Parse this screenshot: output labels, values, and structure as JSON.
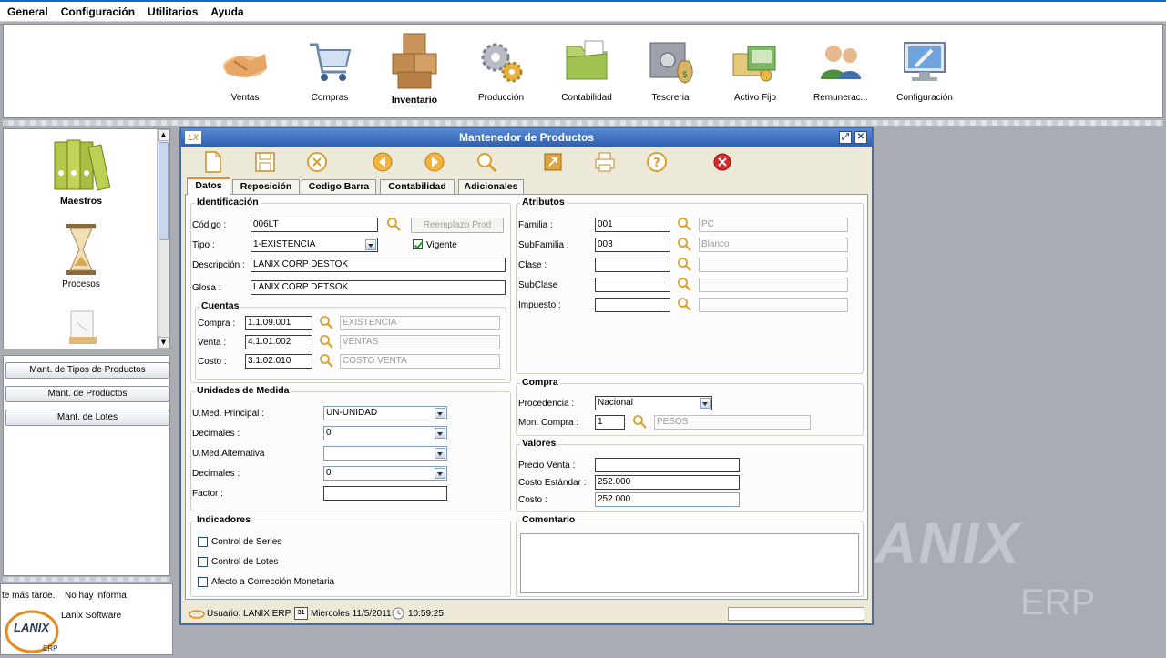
{
  "menu": [
    "General",
    "Configuración",
    "Utilitarios",
    "Ayuda"
  ],
  "toolbar": [
    {
      "label": "Ventas",
      "icon": "handshake-icon"
    },
    {
      "label": "Compras",
      "icon": "shopping-cart-icon"
    },
    {
      "label": "Inventario",
      "icon": "boxes-icon"
    },
    {
      "label": "Producción",
      "icon": "gears-icon"
    },
    {
      "label": "Contabilidad",
      "icon": "folder-icon"
    },
    {
      "label": "Tesoreria",
      "icon": "safe-icon"
    },
    {
      "label": "Activo Fijo",
      "icon": "assets-icon"
    },
    {
      "label": "Remunerac...",
      "icon": "people-icon"
    },
    {
      "label": "Configuración",
      "icon": "monitor-wrench-icon"
    }
  ],
  "left": {
    "modules": [
      {
        "label": "Maestros",
        "icon": "binders-icon"
      },
      {
        "label": "Procesos",
        "icon": "hourglass-icon"
      }
    ],
    "buttons": [
      "Mant. de Tipos de Productos",
      "Mant. de Productos",
      "Mant. de Lotes"
    ],
    "bottom": {
      "line1": "te más tarde.",
      "line1b": "No hay informa",
      "line2": "Lanix Software",
      "logo": "LANIX",
      "logo_sub": "ERP"
    }
  },
  "watermark": {
    "brand": "ANIX",
    "sub": "ERP"
  },
  "window": {
    "title": "Mantenedor de Productos",
    "logo": "LX",
    "tools": [
      "new-document-icon",
      "save-icon",
      "cancel-icon",
      "previous-icon",
      "next-icon",
      "search-icon",
      "export-icon",
      "print-icon",
      "help-icon",
      "close-icon"
    ],
    "tabs": [
      "Datos",
      "Reposición",
      "Codigo Barra",
      "Contabilidad",
      "Adicionales"
    ],
    "identificacion": {
      "title": "Identificación",
      "codigo_label": "Código :",
      "codigo": "006LT",
      "reemplazo": "Reemplazo Prod",
      "tipo_label": "Tipo :",
      "tipo": "1-EXISTENCIA",
      "vigente": "Vigente",
      "descripcion_label": "Descripción :",
      "descripcion": "LANIX CORP DESTOK",
      "glosa_label": "Glosa :",
      "glosa": "LANIX CORP DETSOK"
    },
    "cuentas": {
      "title": "Cuentas",
      "rows": [
        {
          "label": "Compra :",
          "code": "1.1.09.001",
          "desc": "EXISTENCIA"
        },
        {
          "label": "Venta :",
          "code": "4.1.01.002",
          "desc": "VENTAS"
        },
        {
          "label": "Costo :",
          "code": "3.1.02.010",
          "desc": "COSTO VENTA"
        }
      ]
    },
    "atributos": {
      "title": "Atributos",
      "rows": [
        {
          "label": "Familia :",
          "code": "001",
          "desc": "PC"
        },
        {
          "label": "SubFamilia :",
          "code": "003",
          "desc": "Blanco"
        },
        {
          "label": "Clase :",
          "code": "",
          "desc": ""
        },
        {
          "label": "SubClase",
          "code": "",
          "desc": ""
        },
        {
          "label": "Impuesto :",
          "code": "",
          "desc": ""
        }
      ]
    },
    "unidades": {
      "title": "Unidades de Medida",
      "umed_label": "U.Med. Principal :",
      "umed": "UN-UNIDAD",
      "dec1_label": "Decimales :",
      "dec1": "0",
      "umed_alt_label": "U.Med.Alternativa",
      "umed_alt": "",
      "dec2_label": "Decimales :",
      "dec2": "0",
      "factor_label": "Factor :",
      "factor": ""
    },
    "compra": {
      "title": "Compra",
      "procedencia_label": "Procedencia :",
      "procedencia": "Nacional",
      "moneda_label": "Mon. Compra :",
      "moneda": "1",
      "moneda_desc": "PESOS"
    },
    "valores": {
      "title": "Valores",
      "precio_label": "Precio Venta :",
      "precio": "",
      "costo_std_label": "Costo Estándar :",
      "costo_std": "252.000",
      "costo_label": "Costo :",
      "costo": "252.000"
    },
    "indicadores": {
      "title": "Indicadores",
      "items": [
        "Control de Series",
        "Control de Lotes",
        "Afecto a Corrección Monetaria"
      ]
    },
    "comentario": {
      "title": "Comentario",
      "text": ""
    },
    "status": {
      "usuario": "Usuario: LANIX ERP",
      "cal": "31",
      "fecha": "Miercoles 11/5/2011",
      "hora": "10:59:25"
    }
  }
}
